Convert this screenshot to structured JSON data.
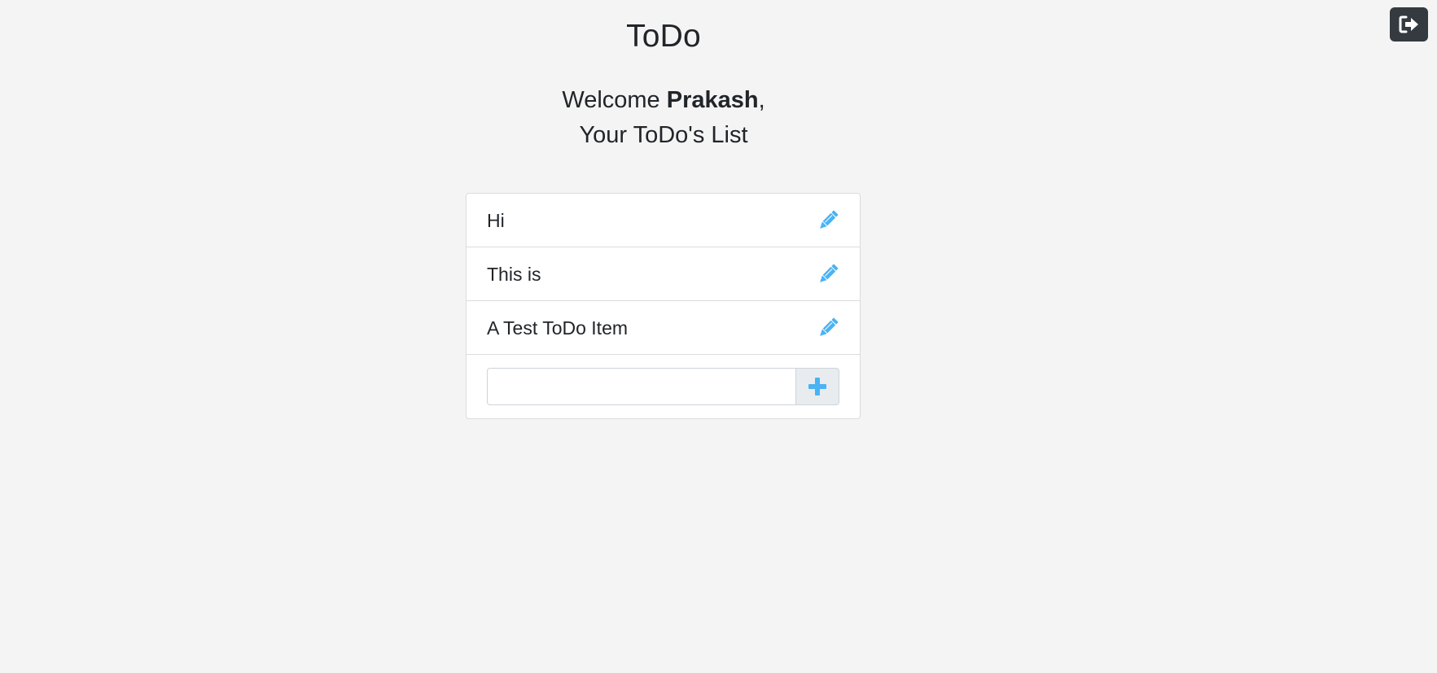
{
  "header": {
    "title": "ToDo",
    "logout_icon": "sign-out-icon"
  },
  "welcome": {
    "greeting": "Welcome ",
    "user_name": "Prakash",
    "comma": ",",
    "subtitle": "Your ToDo's List"
  },
  "todos": {
    "items": [
      {
        "text": "Hi",
        "icon": "pencil-icon"
      },
      {
        "text": "This is",
        "icon": "pencil-icon"
      },
      {
        "text": "A Test ToDo Item",
        "icon": "pencil-icon"
      }
    ]
  },
  "add_form": {
    "input_value": "",
    "placeholder": "",
    "button_icon": "plus-icon"
  },
  "colors": {
    "background": "#f4f4f4",
    "accent": "#4ab3f4",
    "dark_button": "#343a40",
    "card": "#ffffff",
    "border": "#dcdcdc"
  }
}
